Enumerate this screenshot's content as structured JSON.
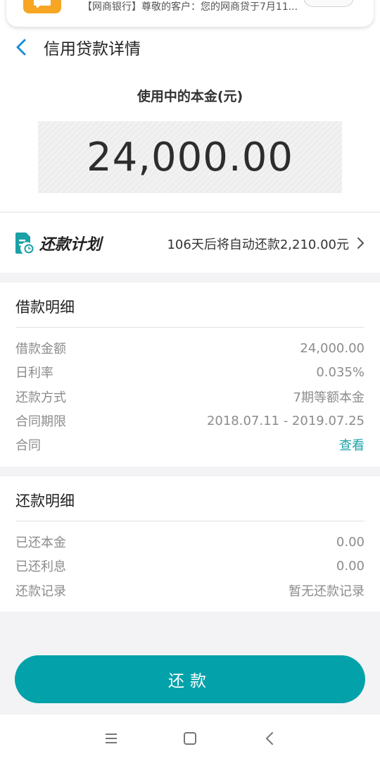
{
  "notification": {
    "text": "【网商银行】尊敬的客户：您的网商贷于7月11..."
  },
  "header": {
    "back_icon": "chevron-left-icon",
    "title": "信用贷款详情"
  },
  "principal": {
    "label": "使用中的本金(元)",
    "amount": "24,000.00"
  },
  "plan": {
    "icon": "calendar-doc-icon",
    "label": "还款计划",
    "info": "106天后将自动还款2,210.00元"
  },
  "loan_details": {
    "title": "借款明细",
    "rows": [
      {
        "label": "借款金额",
        "value": "24,000.00"
      },
      {
        "label": "日利率",
        "value": "0.035%"
      },
      {
        "label": "还款方式",
        "value": "7期等额本金"
      },
      {
        "label": "合同期限",
        "value": "2018.07.11 - 2019.07.25"
      },
      {
        "label": "合同",
        "value": "查看"
      }
    ]
  },
  "repay_details": {
    "title": "还款明细",
    "rows": [
      {
        "label": "已还本金",
        "value": "0.00"
      },
      {
        "label": "已还利息",
        "value": "0.00"
      },
      {
        "label": "还款记录",
        "value": "暂无还款记录"
      }
    ]
  },
  "repay_button": {
    "label": "还款"
  },
  "colors": {
    "accent": "#03a2ab",
    "link": "#1ea3a8",
    "notification_icon": "#f6a623"
  }
}
